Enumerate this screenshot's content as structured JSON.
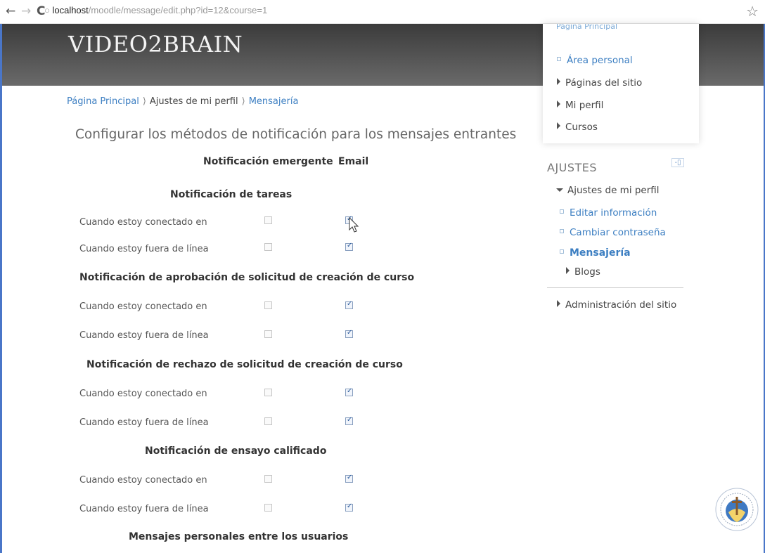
{
  "browser": {
    "url_host": "localhost",
    "url_path": "/moodle/message/edit.php?id=12&course=1"
  },
  "header": {
    "brand": "VIDEO2BRAIN"
  },
  "navigation": {
    "top_cut": "Página Principal",
    "items": [
      {
        "label": "Área personal",
        "type": "link"
      },
      {
        "label": "Páginas del sitio",
        "type": "branch"
      },
      {
        "label": "Mi perfil",
        "type": "branch"
      },
      {
        "label": "Cursos",
        "type": "branch"
      }
    ]
  },
  "settings": {
    "title": "AJUSTES",
    "profile_label": "Ajustes de mi perfil",
    "sub_items": [
      {
        "label": "Editar información"
      },
      {
        "label": "Cambiar contraseña"
      },
      {
        "label": "Mensajería",
        "active": true
      }
    ],
    "blogs_label": "Blogs",
    "admin_label": "Administración del sitio"
  },
  "breadcrumb": {
    "home": "Página Principal",
    "profile": "Ajustes de mi perfil",
    "current": "Mensajería"
  },
  "page": {
    "title": "Configurar los métodos de notificación para los mensajes entrantes",
    "col_popup": "Notificación emergente",
    "col_email": "Email"
  },
  "sections": [
    {
      "title": "Notificación de tareas",
      "rows": [
        {
          "label": "Cuando estoy conectado en",
          "popup": false,
          "email": true
        },
        {
          "label": "Cuando estoy fuera de línea",
          "popup": false,
          "email": true
        }
      ]
    },
    {
      "title": "Notificación de aprobación de solicitud de creación de curso",
      "rows": [
        {
          "label": "Cuando estoy conectado en",
          "popup": false,
          "email": true
        },
        {
          "label": "Cuando estoy fuera de línea",
          "popup": false,
          "email": true
        }
      ]
    },
    {
      "title": "Notificación de rechazo de solicitud de creación de curso",
      "rows": [
        {
          "label": "Cuando estoy conectado en",
          "popup": false,
          "email": true
        },
        {
          "label": "Cuando estoy fuera de línea",
          "popup": false,
          "email": true
        }
      ]
    },
    {
      "title": "Notificación de ensayo calificado",
      "rows": [
        {
          "label": "Cuando estoy conectado en",
          "popup": false,
          "email": true
        },
        {
          "label": "Cuando estoy fuera de línea",
          "popup": false,
          "email": true
        }
      ]
    },
    {
      "title": "Mensajes personales entre los usuarios",
      "rows": []
    }
  ],
  "icons": {
    "back": "back-arrow-icon",
    "forward": "forward-arrow-icon",
    "reload": "reload-icon",
    "page": "page-icon",
    "bookmark": "star-icon",
    "collapse": "collapse-block-icon",
    "cursor": "mouse-pointer-icon",
    "logo": "university-seal-icon"
  },
  "colors": {
    "link": "#3d7fc2",
    "frame": "#4a76c8",
    "banner": "#4a4a4a"
  }
}
